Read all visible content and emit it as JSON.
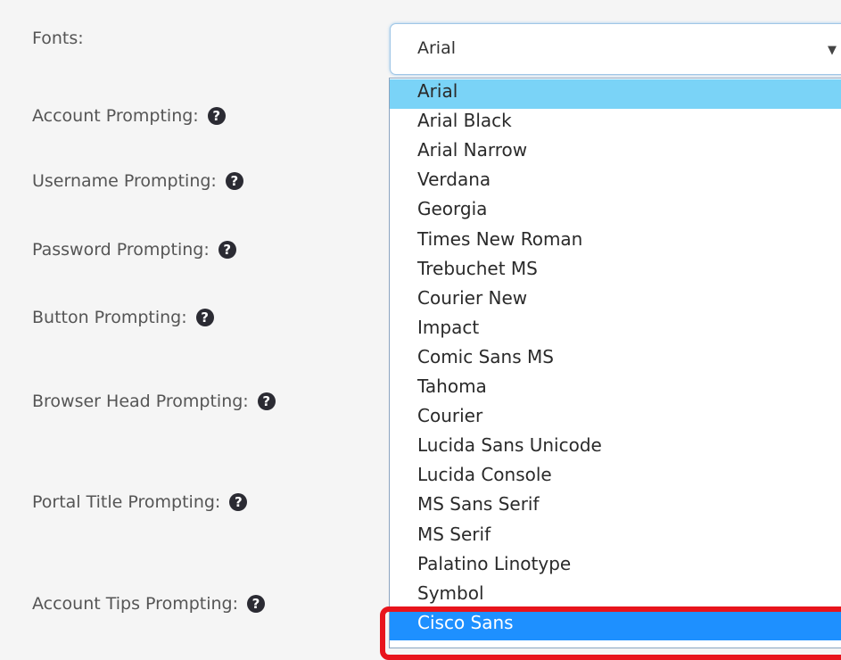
{
  "form": {
    "labels": [
      {
        "text": "Fonts:",
        "has_help": false
      },
      {
        "text": "Account Prompting:",
        "has_help": true
      },
      {
        "text": "Username Prompting:",
        "has_help": true
      },
      {
        "text": "Password Prompting:",
        "has_help": true
      },
      {
        "text": "Button Prompting:",
        "has_help": true
      },
      {
        "text": "Browser Head Prompting:",
        "has_help": true
      },
      {
        "text": "Portal Title Prompting:",
        "has_help": true
      },
      {
        "text": "Account Tips Prompting:",
        "has_help": true
      }
    ],
    "help_icon_glyph": "?"
  },
  "fonts_select": {
    "value": "Arial",
    "arrow_glyph": "▼",
    "options": [
      "Arial",
      "Arial Black",
      "Arial Narrow",
      "Verdana",
      "Georgia",
      "Times New Roman",
      "Trebuchet MS",
      "Courier New",
      "Impact",
      "Comic Sans MS",
      "Tahoma",
      "Courier",
      "Lucida Sans Unicode",
      "Lucida Console",
      "MS Sans Serif",
      "MS Serif",
      "Palatino Linotype",
      "Symbol",
      "Cisco Sans"
    ],
    "current_index": 0,
    "hovered_index": 18
  },
  "colors": {
    "page_bg": "#f5f5f5",
    "label_text": "#555555",
    "help_icon_bg": "#2b2b33",
    "current_option_bg": "#7ad3f7",
    "hovered_option_bg": "#1e90ff",
    "annotation_red": "#e8141c"
  },
  "icons": {
    "help": "question-circle-icon",
    "dropdown_arrow": "caret-down-icon"
  }
}
